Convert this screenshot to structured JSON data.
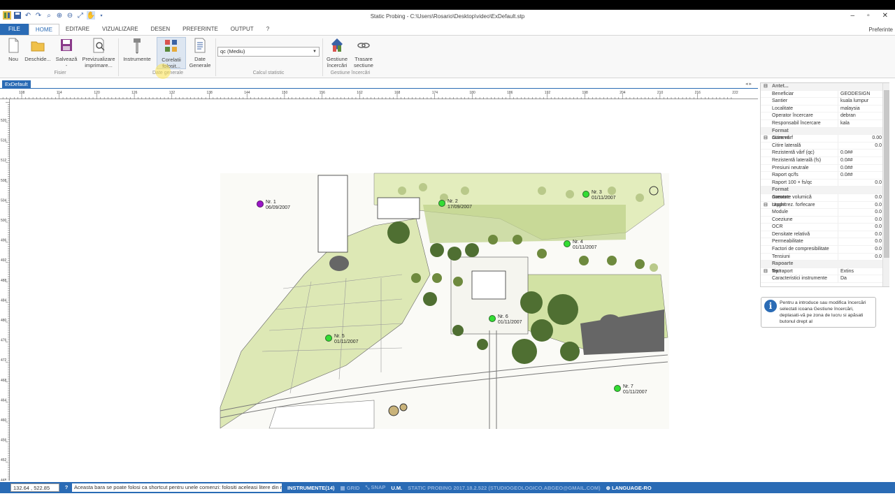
{
  "window": {
    "title": "Static Probing - C:\\Users\\Rosario\\Desktop\\video\\ExDefault.stp"
  },
  "tabs": [
    {
      "label": "FILE"
    },
    {
      "label": "HOME"
    },
    {
      "label": "EDITARE"
    },
    {
      "label": "VIZUALIZARE"
    },
    {
      "label": "DESEN"
    },
    {
      "label": "PREFERINTE"
    },
    {
      "label": "OUTPUT"
    },
    {
      "label": "?"
    }
  ],
  "active_tab": "HOME",
  "preferinte_link": "Preferinte",
  "ribbon": {
    "nou": "Nou",
    "deschide": "Deschide...",
    "salveaza": "Salvează",
    "salveaza2": "-",
    "preview1": "Previzualizare",
    "preview2": "imprimare...",
    "group_fisier": "Fisier",
    "instrumente": "Instrumente",
    "corelatii1": "Corelatii",
    "corelatii2": "folosit...",
    "date1": "Date",
    "date2": "Generale",
    "group_date": "Date generale",
    "combo_value": "qc (Mediu)",
    "group_calcul": "Calcul statistic",
    "gest1": "Gestiune",
    "gest2": "încercări",
    "tras1": "Trasare",
    "tras2": "sectiune",
    "group_gest": "Gestiune încercări"
  },
  "document_tab": "ExDefault",
  "ruler": {
    "h": [
      "108",
      "114",
      "120",
      "126",
      "132",
      "138",
      "144",
      "150",
      "156",
      "162",
      "168",
      "174",
      "180",
      "186",
      "192",
      "198",
      "204",
      "210",
      "216",
      "222"
    ],
    "v": [
      "520",
      "516",
      "512",
      "508",
      "504",
      "500",
      "496",
      "492",
      "488",
      "484",
      "480",
      "476",
      "472",
      "468",
      "464",
      "460",
      "456",
      "452",
      "448"
    ]
  },
  "probes": [
    {
      "name": "Nr. 1",
      "date": "06/09/2007",
      "color": "#9b16c7"
    },
    {
      "name": "Nr. 2",
      "date": "17/09/2007",
      "color": "#33dd33"
    },
    {
      "name": "Nr. 3",
      "date": "01/11/2007",
      "color": "#33dd33"
    },
    {
      "name": "Nr. 4",
      "date": "01/11/2007",
      "color": "#33dd33"
    },
    {
      "name": "Nr. 5",
      "date": "01/11/2007",
      "color": "#33dd33"
    },
    {
      "name": "Nr. 6",
      "date": "01/11/2007",
      "color": "#33dd33"
    },
    {
      "name": "Nr. 7",
      "date": "01/11/2007",
      "color": "#33dd33"
    }
  ],
  "properties": [
    {
      "cat": "Antet..."
    },
    {
      "k": "Beneficiar",
      "v": "GEODESIGN"
    },
    {
      "k": "Santier",
      "v": "kuala lumpur"
    },
    {
      "k": "Localitate",
      "v": "malaysia"
    },
    {
      "k": "Operator încercare",
      "v": "debran"
    },
    {
      "k": "Responsabil încercare",
      "v": "kala"
    },
    {
      "cat": "Format numere"
    },
    {
      "k": "Citire vârf",
      "v": "0.00",
      "num": true
    },
    {
      "k": "Citire laterală",
      "v": "0.0",
      "num": true
    },
    {
      "k": "Rezistentă vârf (qc)",
      "v": "0.0##"
    },
    {
      "k": "Rezistentă laterală (fs)",
      "v": "0.0##"
    },
    {
      "k": "Presiuni neutrale",
      "v": "0.0##"
    },
    {
      "k": "Raport qc/fs",
      "v": "0.0##"
    },
    {
      "k": "Raport 100 × fs/qc",
      "v": "0.0",
      "num": true
    },
    {
      "cat": "Format numere raport"
    },
    {
      "k": "Greutate volumică",
      "v": "0.0",
      "num": true
    },
    {
      "k": "Unghi rez. forfecare",
      "v": "0.0",
      "num": true
    },
    {
      "k": "Module",
      "v": "0.0",
      "num": true
    },
    {
      "k": "Coeziune",
      "v": "0.0",
      "num": true
    },
    {
      "k": "OCR",
      "v": "0.0",
      "num": true
    },
    {
      "k": "Densitate relativă",
      "v": "0.0",
      "num": true
    },
    {
      "k": "Permeabilitate",
      "v": "0.0",
      "num": true
    },
    {
      "k": "Factori de compresibilitate",
      "v": "0.0",
      "num": true
    },
    {
      "k": "Tensiuni",
      "v": "0.0",
      "num": true
    },
    {
      "cat": "Rapoarte text"
    },
    {
      "k": "Tip raport",
      "v": "Extins"
    },
    {
      "k": "Caracteristici instrumente",
      "v": "Da"
    }
  ],
  "info_text": "Pentru a introduce sau modifica încercări selectati icoana Gestiune încercări, deplasati-vă pe zona de lucru si apăsati butonul drept al",
  "status": {
    "coords": "132.64 , 522.85",
    "hint": "Aceasta bara se poate folosi ca shortcut pentru unele comenzi: folositi aceleasi litere din meniu",
    "instrumente": "INSTRUMENTE(14)",
    "grid": "GRID",
    "snap": "SNAP",
    "um": "U.M.",
    "version": "STATIC PROBING 2017.18.2.522 (STUDIOGEOLOGICO.ABGEO@GMAIL.COM)",
    "language": "LANGUAGE-RO"
  }
}
